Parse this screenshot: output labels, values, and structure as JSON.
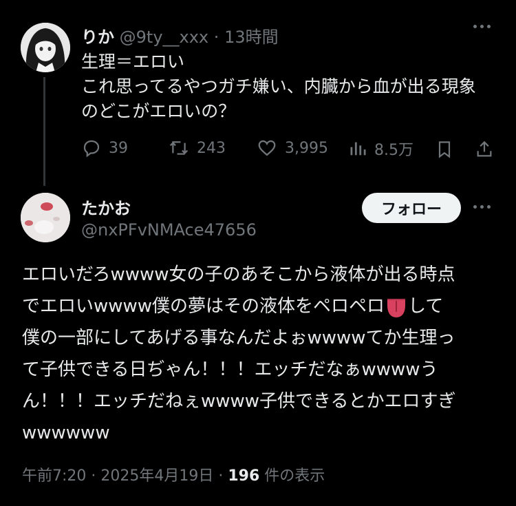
{
  "tweet1": {
    "name": "りか",
    "handle": "@9ty__xxx",
    "separator": "·",
    "time": "13時間",
    "text": "生理＝エロい\nこれ思ってるやつガチ嫌い、内臓から血が出る現象\nのどこがエロいの？",
    "actions": {
      "reply": "39",
      "retweet": "243",
      "like": "3,995",
      "views": "8.5万"
    }
  },
  "tweet2": {
    "name": "たかお",
    "handle": "@nxPFvNMAce47656",
    "follow_label": "フォロー",
    "text_part1": "エロいだろwwww女の子のあそこから液体が出る時点\nでエロいwwww僕の夢はその液体をペロペロ",
    "text_part2": "して\n僕の一部にしてあげる事なんだよぉwwwwてか生理っ\nて子供できる日ぢゃん！！！エッチだなぁwwwwう\nん！！！エッチだねぇwwww子供できるとかエロすぎ\nwwwwww",
    "meta": {
      "timestamp": "午前7:20 · 2025年4月19日 ·",
      "view_count": "196",
      "views_label": "件の表示"
    }
  },
  "icons": {
    "reply": "reply-icon",
    "retweet": "retweet-icon",
    "like": "heart-icon",
    "views": "views-icon",
    "bookmark": "bookmark-icon",
    "share": "share-icon",
    "more": "more-icon",
    "emoji": "tongue-emoji-icon"
  },
  "colors": {
    "background": "#000000",
    "text": "#e7e9ea",
    "muted": "#71767b",
    "follow_bg": "#eff3f4"
  }
}
